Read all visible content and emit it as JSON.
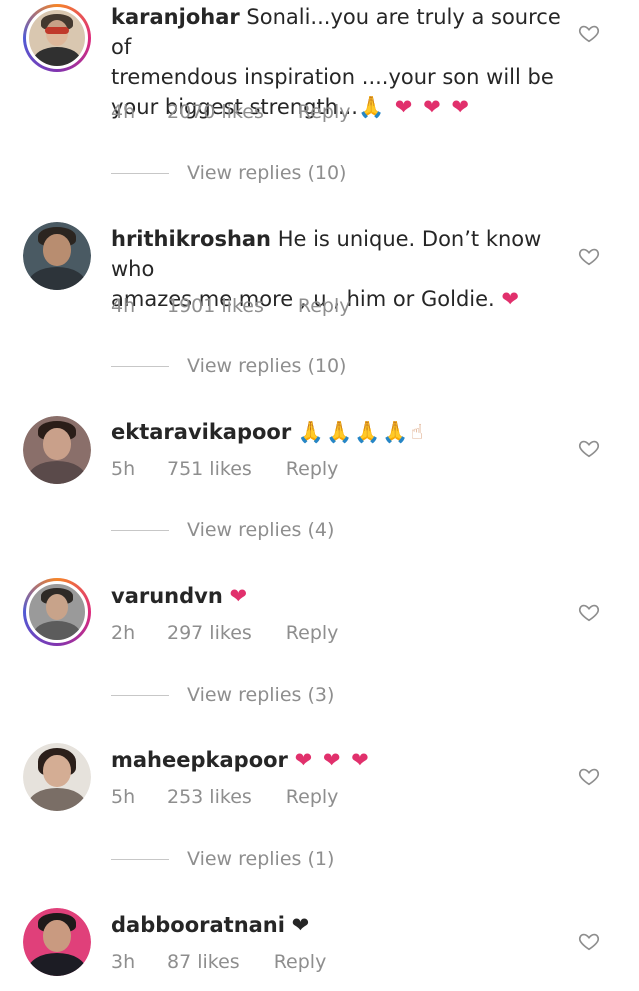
{
  "comments": [
    {
      "username": "karanjohar",
      "text": "Sonali...you are truly a source of\ntremendous inspiration ....your son will be\nyour biggest strength...",
      "emoji": "🙏 ❤ ❤ ❤",
      "time": "4h",
      "likes": "2070 likes",
      "reply": "Reply",
      "view_replies": "View replies (10)"
    },
    {
      "username": "hrithikroshan",
      "text": "He is unique. Don’t know who\namazes me more , u , him or Goldie.",
      "emoji": "❤",
      "time": "4h",
      "likes": "1901 likes",
      "reply": "Reply",
      "view_replies": "View replies (10)"
    },
    {
      "username": "ektaravikapoor",
      "text": "",
      "emoji": "🙏🙏🙏🙏☝",
      "time": "5h",
      "likes": "751 likes",
      "reply": "Reply",
      "view_replies": "View replies (4)"
    },
    {
      "username": "varundvn",
      "text": "",
      "emoji": "❤",
      "time": "2h",
      "likes": "297 likes",
      "reply": "Reply",
      "view_replies": "View replies (3)"
    },
    {
      "username": "maheepkapoor",
      "text": "",
      "emoji": "❤ ❤ ❤",
      "time": "5h",
      "likes": "253 likes",
      "reply": "Reply",
      "view_replies": "View replies (1)"
    },
    {
      "username": "dabbooratnani",
      "text": "",
      "emoji": "❤",
      "time": "3h",
      "likes": "87 likes",
      "reply": "Reply"
    }
  ],
  "icons": {
    "like": "heart-outline-icon"
  },
  "colors": {
    "text": "#262626",
    "meta": "#8e8e8e",
    "heart_emoji": "#e1306c"
  }
}
